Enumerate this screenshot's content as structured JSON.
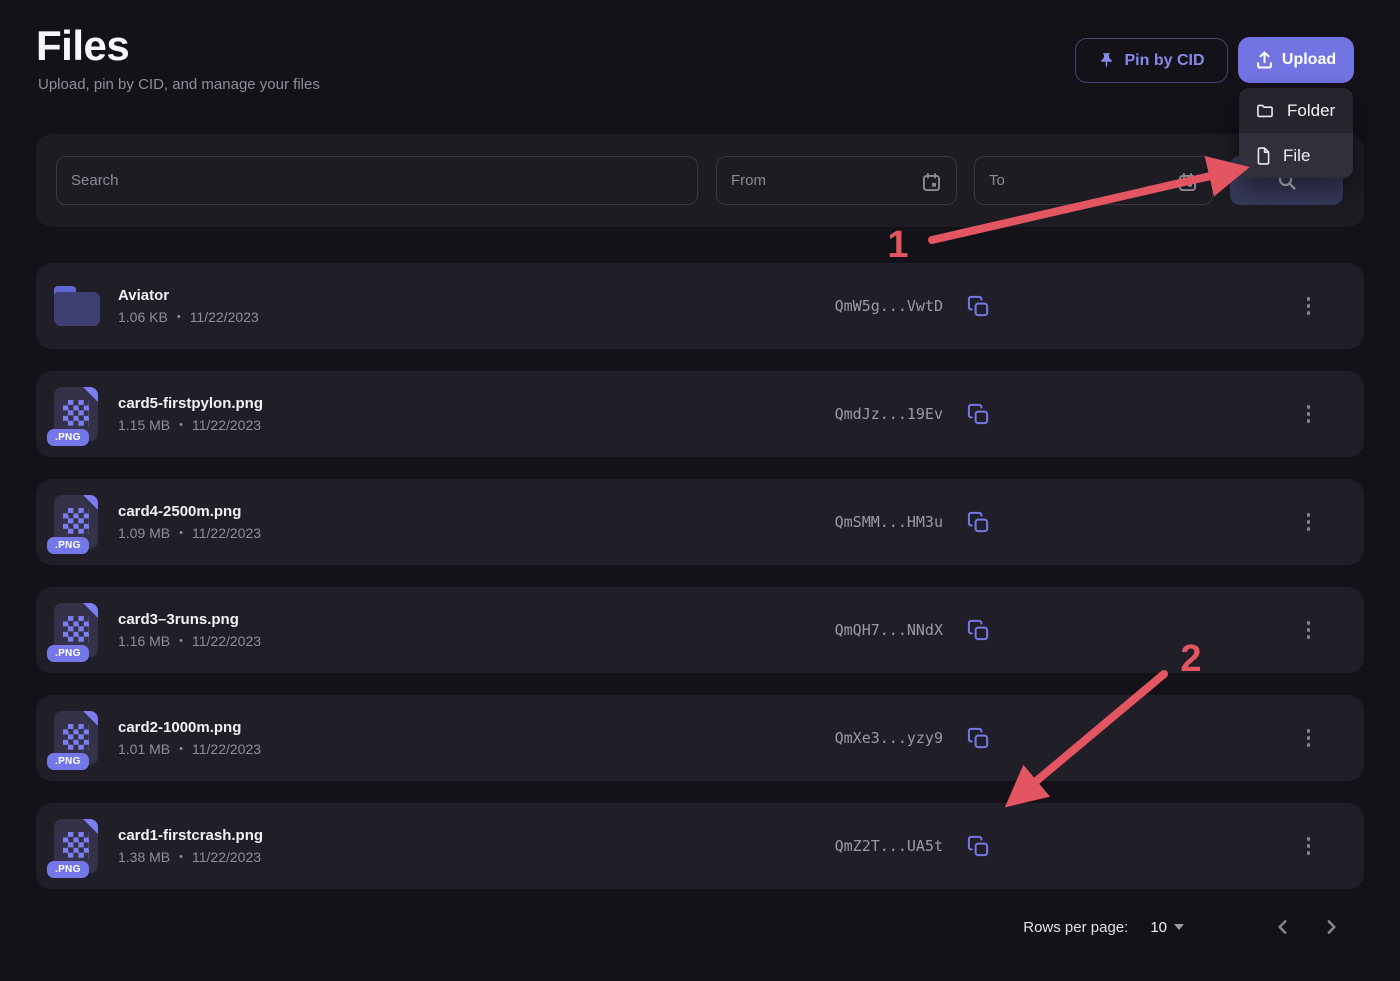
{
  "page": {
    "title": "Files",
    "subtitle": "Upload, pin by CID, and manage your files"
  },
  "actions": {
    "pin_by_cid_label": "Pin by CID",
    "upload_label": "Upload"
  },
  "upload_menu": {
    "items": [
      {
        "label": "Folder",
        "icon": "folder-icon"
      },
      {
        "label": "File",
        "icon": "file-icon"
      }
    ]
  },
  "filters": {
    "search_placeholder": "Search",
    "from_placeholder": "From",
    "to_placeholder": "To"
  },
  "meta_separator": "•",
  "files": [
    {
      "name": "Aviator",
      "type": "folder",
      "badge": "",
      "size": "1.06 KB",
      "date": "11/22/2023",
      "cid": "QmW5g...VwtD"
    },
    {
      "name": "card5-firstpylon.png",
      "type": "png",
      "badge": ".PNG",
      "size": "1.15 MB",
      "date": "11/22/2023",
      "cid": "QmdJz...19Ev"
    },
    {
      "name": "card4-2500m.png",
      "type": "png",
      "badge": ".PNG",
      "size": "1.09 MB",
      "date": "11/22/2023",
      "cid": "QmSMM...HM3u"
    },
    {
      "name": "card3–3runs.png",
      "type": "png",
      "badge": ".PNG",
      "size": "1.16 MB",
      "date": "11/22/2023",
      "cid": "QmQH7...NNdX"
    },
    {
      "name": "card2-1000m.png",
      "type": "png",
      "badge": ".PNG",
      "size": "1.01 MB",
      "date": "11/22/2023",
      "cid": "QmXe3...yzy9"
    },
    {
      "name": "card1-firstcrash.png",
      "type": "png",
      "badge": ".PNG",
      "size": "1.38 MB",
      "date": "11/22/2023",
      "cid": "QmZ2T...UA5t"
    }
  ],
  "pagination": {
    "rows_per_page_label": "Rows per page:",
    "rows_per_page_value": "10"
  },
  "annotations": [
    {
      "label": "1",
      "target": "upload-menu-item-file"
    },
    {
      "label": "2",
      "target": "copy-cid-button-row-6"
    }
  ],
  "colors": {
    "accent_purple": "#7274e2",
    "accent_purple_light": "#8789ea",
    "annotation_red": "#e25561",
    "page_bg": "#141219",
    "row_bg": "#201f27"
  }
}
